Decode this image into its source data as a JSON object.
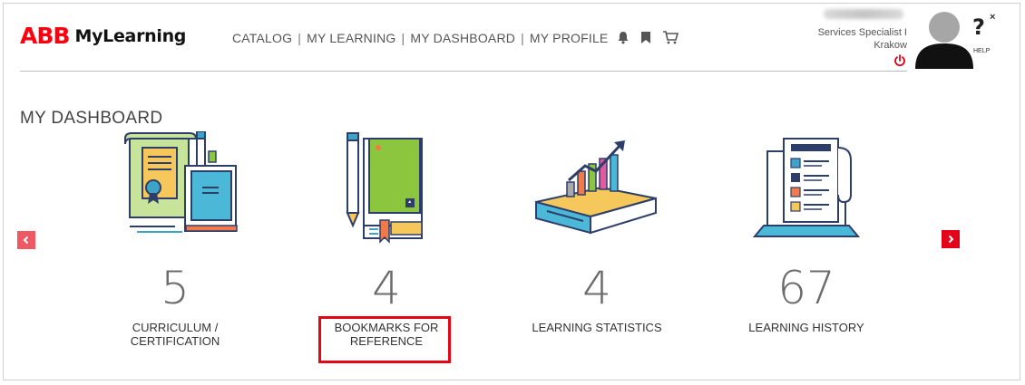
{
  "brand": {
    "logo_text": "ABB",
    "product": "MyLearning"
  },
  "nav": {
    "items": [
      "CATALOG",
      "MY LEARNING",
      "MY DASHBOARD",
      "MY PROFILE"
    ],
    "separator": "|"
  },
  "header_icons": [
    "bell-icon",
    "bookmark-icon",
    "cart-icon"
  ],
  "user": {
    "role_line1": "Services Specialist I",
    "role_line2": "Krakow",
    "logout_icon": "power-icon"
  },
  "help": {
    "label": "HELP"
  },
  "page": {
    "title": "MY DASHBOARD"
  },
  "carousel": {
    "prev_icon": "chevron-left-icon",
    "next_icon": "chevron-right-icon",
    "cards": [
      {
        "count": "5",
        "label_line1": "CURRICULUM /",
        "label_line2": "CERTIFICATION",
        "icon": "certificate-illustration"
      },
      {
        "count": "4",
        "label_line1": "BOOKMARKS FOR",
        "label_line2": "REFERENCE",
        "icon": "bookmark-book-illustration"
      },
      {
        "count": "4",
        "label_line1": "LEARNING STATISTICS",
        "label_line2": "",
        "icon": "statistics-illustration"
      },
      {
        "count": "67",
        "label_line1": "LEARNING HISTORY",
        "label_line2": "",
        "icon": "history-illustration"
      }
    ]
  },
  "colors": {
    "brand_red": "#ff000f",
    "highlight_red": "#e30613",
    "arrow_left": "#ef5964",
    "arrow_right": "#e4001b"
  }
}
